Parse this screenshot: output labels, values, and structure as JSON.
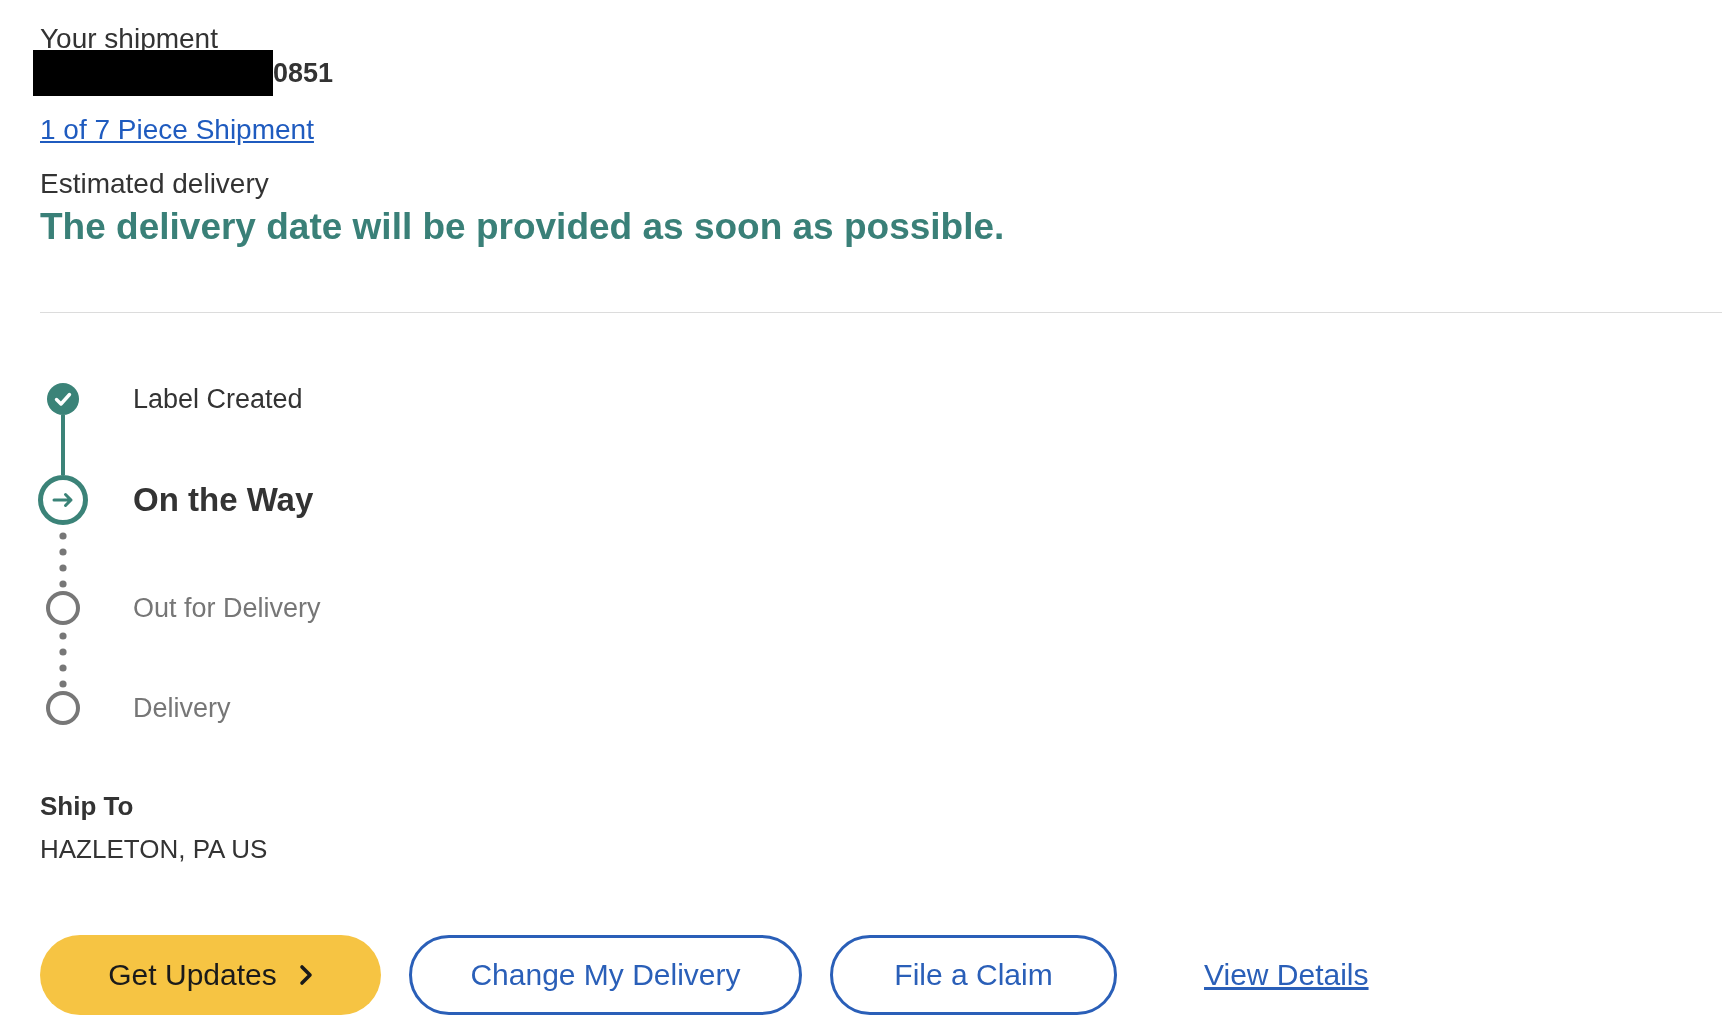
{
  "shipment": {
    "label": "Your shipment",
    "tracking_number": {
      "redacted": true,
      "visible_text": "0851"
    },
    "piece_link": "1 of 7 Piece Shipment"
  },
  "estimated_delivery": {
    "label": "Estimated delivery",
    "message": "The delivery date will be provided as soon as possible."
  },
  "progress_steps": [
    {
      "label": "Label Created",
      "kind": "done"
    },
    {
      "label": "On the Way",
      "kind": "current"
    },
    {
      "label": "Out for Delivery",
      "kind": "upcoming"
    },
    {
      "label": "Delivery",
      "kind": "upcoming"
    }
  ],
  "ship_to": {
    "label": "Ship To",
    "address": "HAZLETON, PA US"
  },
  "actions": [
    {
      "label": "Get Updates",
      "kind": "primary"
    },
    {
      "label": "Change My Delivery",
      "kind": "outline"
    },
    {
      "label": "File a Claim",
      "kind": "outline"
    },
    {
      "label": "View Details",
      "kind": "link"
    }
  ]
}
